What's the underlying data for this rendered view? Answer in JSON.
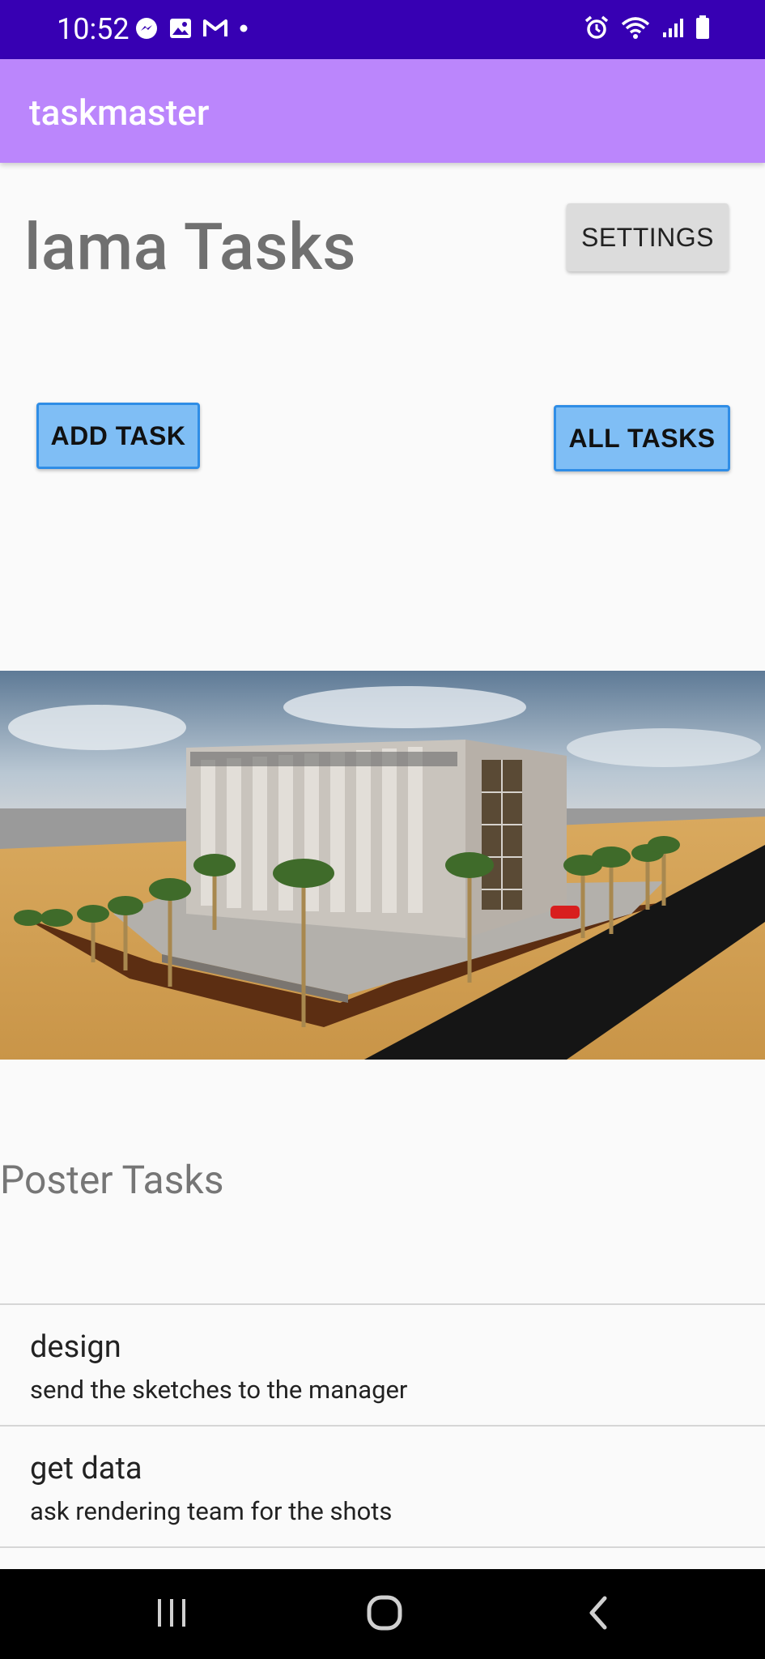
{
  "status_bar": {
    "time": "10:52",
    "left_icons": [
      "messenger-icon",
      "gallery-icon",
      "gmail-icon",
      "dot-icon"
    ],
    "right_icons": [
      "alarm-icon",
      "wifi-icon",
      "signal-icon",
      "battery-icon"
    ],
    "background": "#3700b3"
  },
  "app_bar": {
    "title": "taskmaster",
    "background": "#bb86fc"
  },
  "main": {
    "heading": "lama Tasks",
    "settings_label": "SETTINGS",
    "add_task_label": "ADD TASK",
    "all_tasks_label": "ALL TASKS",
    "hero_image": "building-rendering-image",
    "subheading": "Poster Tasks"
  },
  "tasks": [
    {
      "title": "design",
      "body": "send the sketches to the manager"
    },
    {
      "title": "get data",
      "body": "ask rendering team for the shots"
    }
  ],
  "nav_bar": {
    "buttons": [
      "recent-apps-icon",
      "home-icon",
      "back-icon"
    ]
  },
  "colors": {
    "button_blue": "#7fbef5",
    "button_border": "#2f8de6",
    "heading_gray": "#707070"
  }
}
